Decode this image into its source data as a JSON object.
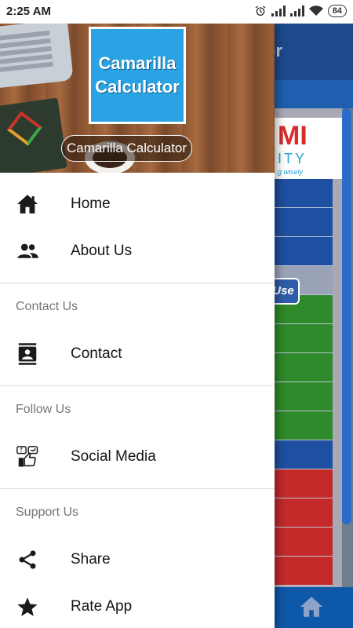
{
  "status_bar": {
    "time": "2:25 AM",
    "battery": "84",
    "icons": [
      "alarm-icon",
      "signal-icon",
      "signal-icon",
      "wifi-icon",
      "battery-icon"
    ]
  },
  "background_app": {
    "toolbar_title_fragment": "or",
    "logo_text": "MI",
    "logo_subtext": "ITY",
    "logo_tagline": "g wisely",
    "button_fragment": "Use",
    "bottom_nav_icon": "home-icon"
  },
  "drawer": {
    "header": {
      "logo_line1": "Camarilla",
      "logo_line2": "Calculator",
      "app_name": "Camarilla Calculator"
    },
    "items": [
      {
        "label": "Home",
        "icon": "home-icon"
      },
      {
        "label": "About Us",
        "icon": "people-icon"
      }
    ],
    "sections": [
      {
        "title": "Contact Us",
        "items": [
          {
            "label": "Contact",
            "icon": "contact-card-icon"
          }
        ]
      },
      {
        "title": "Follow Us",
        "items": [
          {
            "label": "Social Media",
            "icon": "social-media-icon"
          }
        ]
      },
      {
        "title": "Support Us",
        "items": [
          {
            "label": "Share",
            "icon": "share-icon"
          },
          {
            "label": "Rate App",
            "icon": "star-icon"
          }
        ]
      }
    ]
  },
  "colors": {
    "drawer_bg": "#ffffff",
    "section_title": "#757575",
    "logo_blue": "#2aa3e4",
    "toolbar_blue": "#1c4a8c",
    "bottom_nav_blue": "#0d58a8"
  }
}
